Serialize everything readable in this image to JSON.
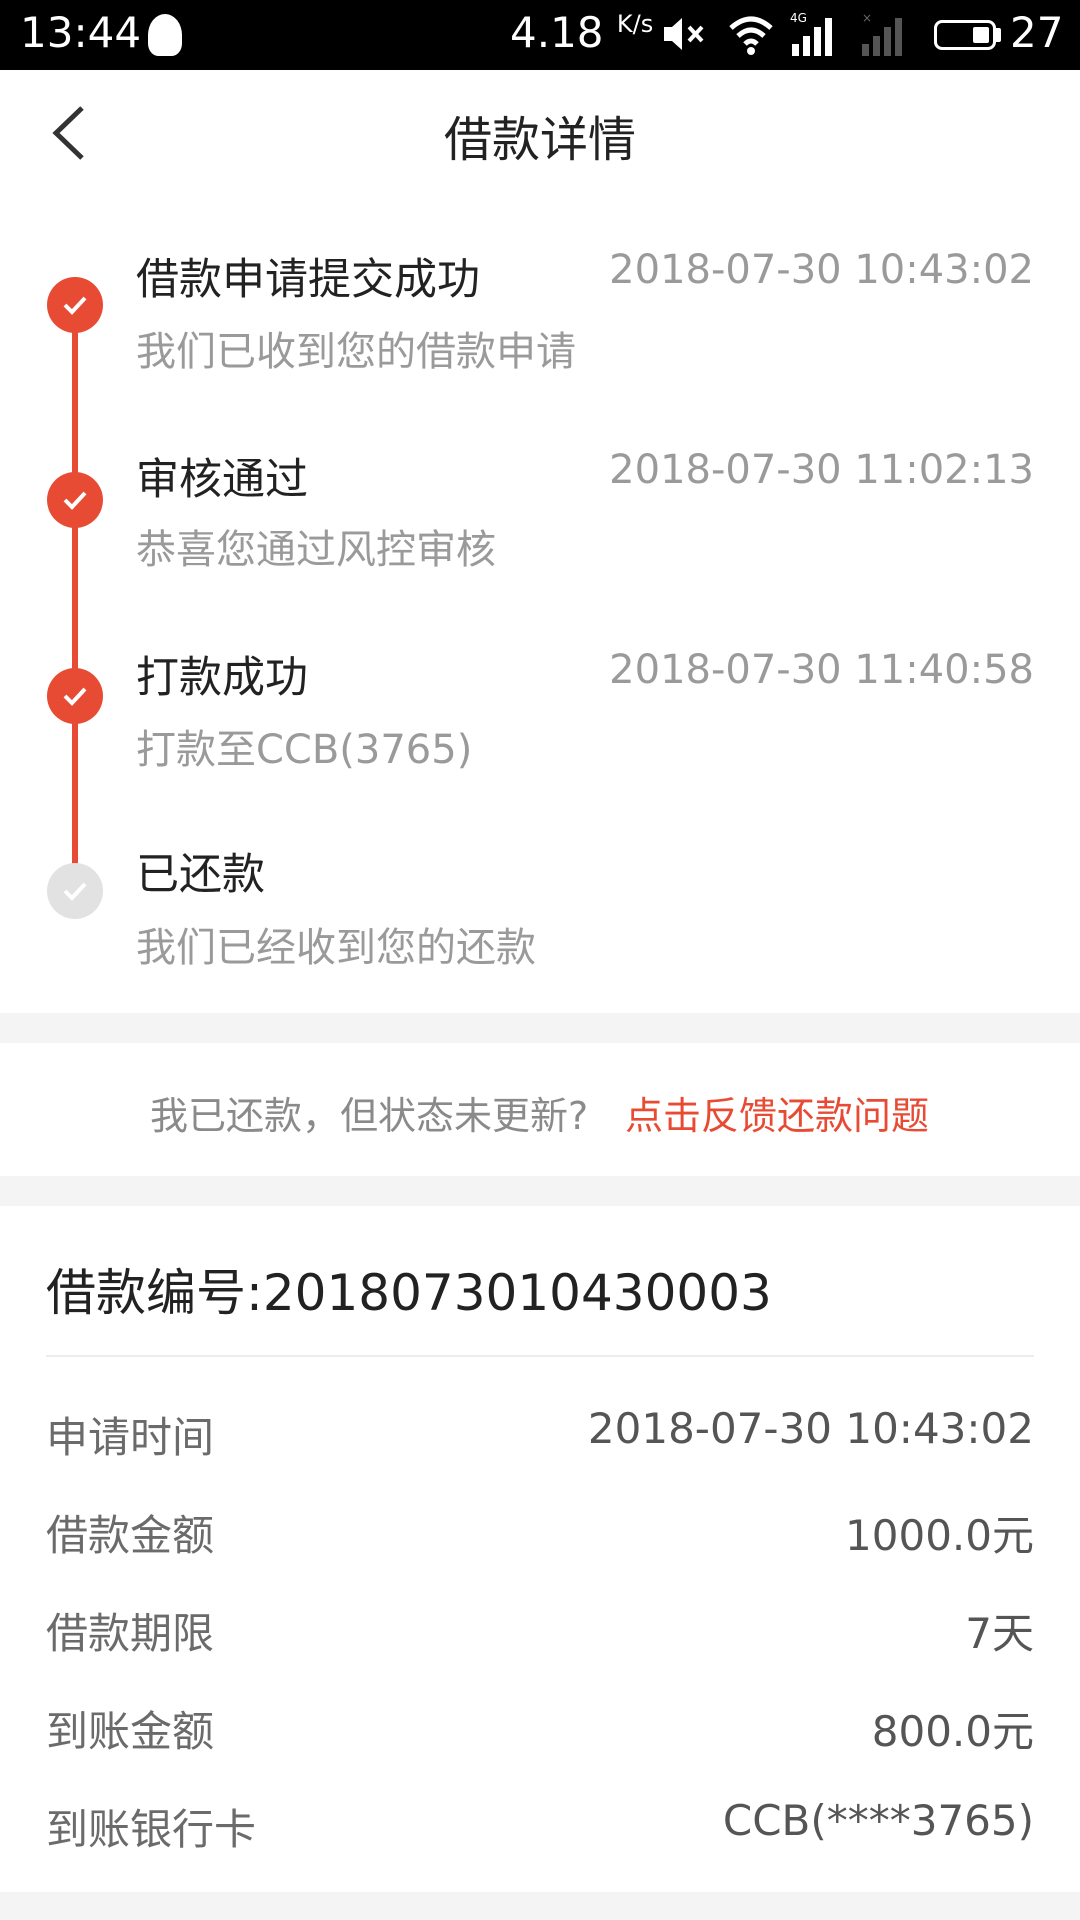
{
  "status_bar": {
    "time": "13:44",
    "speed": "4.18",
    "speed_unit": "K/s",
    "network_type": "4G",
    "battery_level": "27",
    "icons": [
      "qq-icon",
      "mute-icon",
      "wifi-icon",
      "signal-icon",
      "battery-icon"
    ]
  },
  "header": {
    "title": "借款详情",
    "back_icon": "chevron-left-icon"
  },
  "colors": {
    "accent": "#e84b33",
    "pending": "#e2e2e2",
    "muted_text": "#9a9a9a"
  },
  "timeline": {
    "steps": [
      {
        "title": "借款申请提交成功",
        "subtitle": "我们已收到您的借款申请",
        "time": "2018-07-30 10:43:02",
        "status": "done"
      },
      {
        "title": "审核通过",
        "subtitle": "恭喜您通过风控审核",
        "time": "2018-07-30 11:02:13",
        "status": "done"
      },
      {
        "title": "打款成功",
        "subtitle": "打款至CCB(3765)",
        "time": "2018-07-30 11:40:58",
        "status": "done"
      },
      {
        "title": "已还款",
        "subtitle": "我们已经收到您的还款",
        "time": "",
        "status": "pending"
      }
    ]
  },
  "feedback": {
    "text": "我已还款，但状态未更新?",
    "link": "点击反馈还款问题"
  },
  "details": {
    "loan_number": "借款编号:2018073010430003",
    "rows": [
      {
        "label": "申请时间",
        "value": "2018-07-30 10:43:02"
      },
      {
        "label": "借款金额",
        "value": "1000.0元"
      },
      {
        "label": "借款期限",
        "value": "7天"
      },
      {
        "label": "到账金额",
        "value": "800.0元"
      },
      {
        "label": "到账银行卡",
        "value": "CCB(****3765)"
      }
    ]
  }
}
